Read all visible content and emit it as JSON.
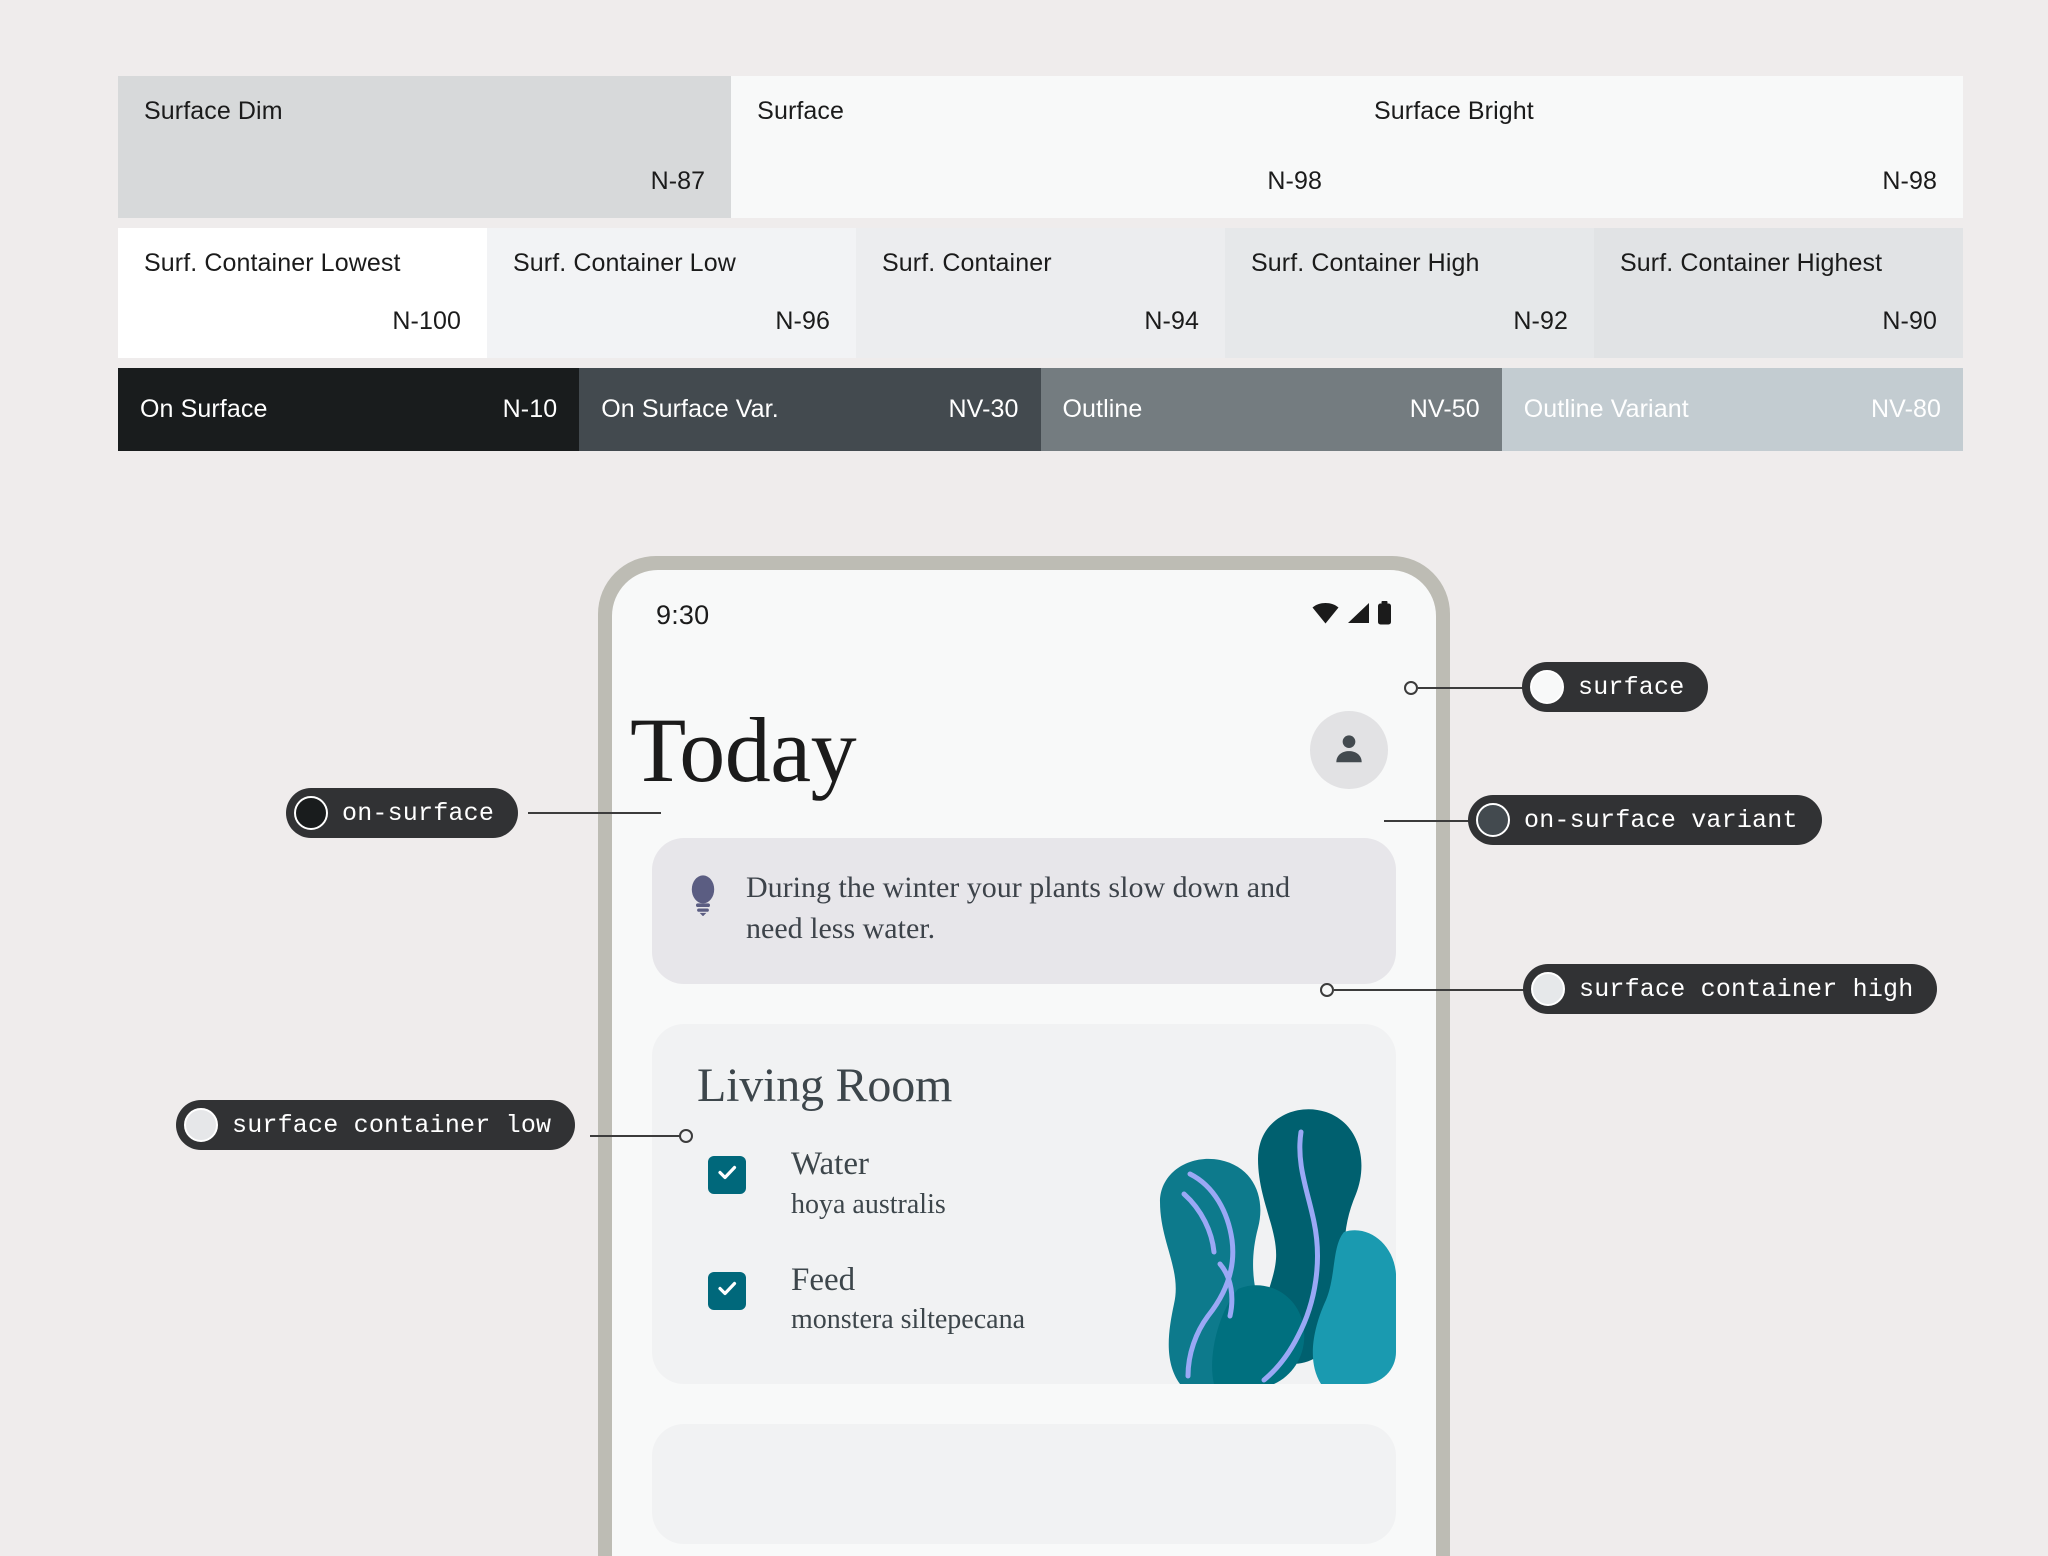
{
  "page": {
    "background": "#efecec"
  },
  "swatches": {
    "row_surfaces": [
      {
        "name": "Surface Dim",
        "tone": "N-87",
        "color": "#d7d9da",
        "text_on_dark": false,
        "flex": 613
      },
      {
        "name": "Surface",
        "tone": "N-98",
        "color": "#f8f9f9",
        "text_on_dark": false,
        "flex": 617
      },
      {
        "name": "Surface Bright",
        "tone": "N-98",
        "color": "#f8f9f9",
        "text_on_dark": false,
        "flex": 615
      }
    ],
    "row_containers": [
      {
        "name": "Surf. Container Lowest",
        "tone": "N-100",
        "color": "#ffffff",
        "text_on_dark": false,
        "flex": 1
      },
      {
        "name": "Surf. Container Low",
        "tone": "N-96",
        "color": "#f2f3f5",
        "text_on_dark": false,
        "flex": 1
      },
      {
        "name": "Surf. Container",
        "tone": "N-94",
        "color": "#ecedef",
        "text_on_dark": false,
        "flex": 1
      },
      {
        "name": "Surf. Container High",
        "tone": "N-92",
        "color": "#e6e8ea",
        "text_on_dark": false,
        "flex": 1
      },
      {
        "name": "Surf. Container Highest",
        "tone": "N-90",
        "color": "#e1e3e5",
        "text_on_dark": false,
        "flex": 1
      }
    ],
    "row_dark": [
      {
        "name": "On Surface",
        "tone": "N-10",
        "color": "#191c1d",
        "text_on_dark": true,
        "flex": 1
      },
      {
        "name": "On Surface Var.",
        "tone": "NV-30",
        "color": "#434a4f",
        "text_on_dark": true,
        "flex": 1
      },
      {
        "name": "Outline",
        "tone": "NV-50",
        "color": "#747c80",
        "text_on_dark": true,
        "flex": 1
      },
      {
        "name": "Outline Variant",
        "tone": "NV-80",
        "color": "#c3ccd1",
        "text_on_dark": true,
        "flex": 1
      }
    ]
  },
  "phone": {
    "frame_color": "#bdbcb4",
    "screen_color": "#f8f9f9",
    "status": {
      "time": "9:30",
      "icons": [
        "wifi-icon",
        "signal-icon",
        "battery-icon"
      ]
    },
    "header": {
      "title": "Today",
      "avatar_icon": "person-icon",
      "avatar_bg": "#e2e2e4"
    },
    "tip_card": {
      "icon": "lightbulb-icon",
      "icon_color": "#5b5d82",
      "background": "#e7e6ea",
      "text": "During the winter your plants slow down and need less water."
    },
    "room_card": {
      "background": "#f1f2f3",
      "title": "Living Room",
      "checkbox_color": "#00687b",
      "tasks": [
        {
          "checked": true,
          "title": "Water",
          "plant": "hoya australis"
        },
        {
          "checked": true,
          "title": "Feed",
          "plant": "monstera siltepecana"
        }
      ],
      "illustration": {
        "name": "plant-illustration",
        "colors": [
          "#0d7a8c",
          "#00606f",
          "#1a9ab0",
          "#9aa8f5"
        ]
      }
    }
  },
  "callouts": [
    {
      "label": "surface",
      "dot_color": "#f8f9f9",
      "side": "right"
    },
    {
      "label": "on-surface",
      "dot_color": "#191c1d",
      "side": "left"
    },
    {
      "label": "on-surface variant",
      "dot_color": "#434a4f",
      "side": "right"
    },
    {
      "label": "surface container high",
      "dot_color": "#e6e8ea",
      "side": "right"
    },
    {
      "label": "surface container low",
      "dot_color": "#e6e7e9",
      "side": "left"
    }
  ]
}
